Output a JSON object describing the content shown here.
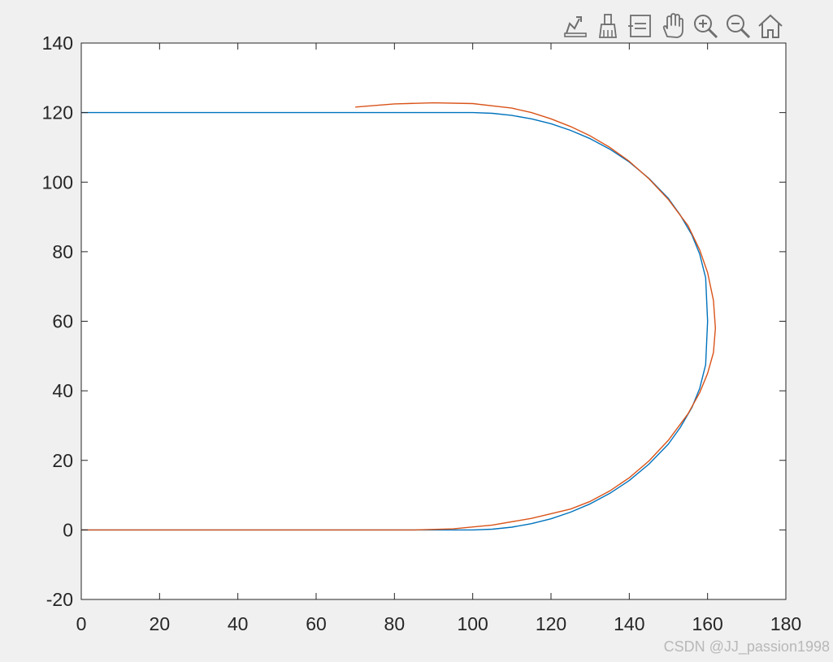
{
  "toolbar": {
    "buttons": [
      {
        "name": "export-icon"
      },
      {
        "name": "brush-icon"
      },
      {
        "name": "datatip-icon"
      },
      {
        "name": "pan-hand-icon"
      },
      {
        "name": "zoom-in-icon"
      },
      {
        "name": "zoom-out-icon"
      },
      {
        "name": "home-icon"
      }
    ]
  },
  "colors": {
    "series1": "#0072bd",
    "series2": "#d95319",
    "axes": "#262626",
    "background": "#f0f0f0"
  },
  "watermark": "CSDN @JJ_passion1998",
  "chart_data": {
    "type": "line",
    "title": "",
    "xlabel": "",
    "ylabel": "",
    "xlim": [
      0,
      180
    ],
    "ylim": [
      -20,
      140
    ],
    "xticks": [
      0,
      20,
      40,
      60,
      80,
      100,
      120,
      140,
      160,
      180
    ],
    "yticks": [
      -20,
      0,
      20,
      40,
      60,
      80,
      100,
      120,
      140
    ],
    "grid": false,
    "series": [
      {
        "x": [
          0,
          100,
          105,
          110,
          115,
          120,
          125,
          130,
          135,
          140,
          145,
          150,
          153,
          156,
          158,
          159.5,
          160,
          159.5,
          158,
          156,
          153,
          150,
          145,
          140,
          135,
          130,
          125,
          120,
          115,
          110,
          105,
          100,
          0
        ],
        "y": [
          0,
          0,
          0.2,
          0.8,
          1.8,
          3.2,
          5.1,
          7.5,
          10.5,
          14.2,
          18.9,
          24.7,
          29.4,
          35.2,
          40.7,
          47.5,
          60,
          72.5,
          79.3,
          84.8,
          90.6,
          95.3,
          101.1,
          105.8,
          109.5,
          112.5,
          114.9,
          116.8,
          118.2,
          119.2,
          119.8,
          120,
          120
        ]
      },
      {
        "x": [
          0,
          85,
          95,
          105,
          115,
          125,
          130,
          135,
          140,
          145,
          150,
          155,
          158,
          160,
          161.5,
          162,
          161.5,
          160,
          158,
          155,
          150,
          145,
          140,
          135,
          130,
          125,
          120,
          115,
          110,
          100,
          90,
          80,
          70
        ],
        "y": [
          0,
          0,
          0.3,
          1.4,
          3.3,
          6,
          8.2,
          11.2,
          15,
          19.8,
          25.8,
          33.4,
          39.5,
          45,
          51,
          58,
          66,
          74,
          80.5,
          87.5,
          95,
          101,
          106,
          110,
          113.3,
          116,
          118.2,
          120,
          121.3,
          122.6,
          122.8,
          122.5,
          121.6
        ]
      }
    ]
  }
}
